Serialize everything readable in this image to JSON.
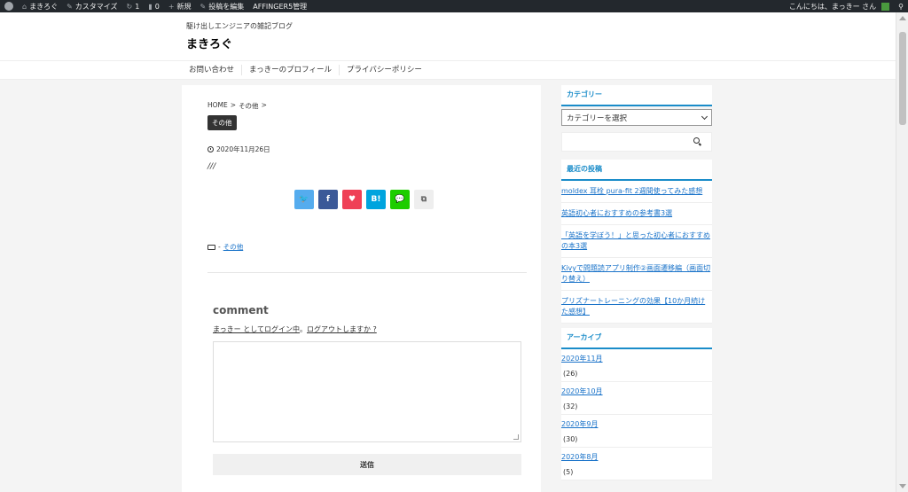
{
  "adminbar": {
    "site_name": "まきろぐ",
    "customize": "カスタマイズ",
    "updates_count": "1",
    "comments_count": "0",
    "new": "新規",
    "edit_post": "投稿を編集",
    "affinger": "AFFINGER5管理",
    "greeting": "こんにちは、まっきー さん"
  },
  "header": {
    "tagline": "駆け出しエンジニアの雑記ブログ",
    "site_title": "まきろぐ"
  },
  "nav": {
    "items": [
      "お問い合わせ",
      "まっきーのプロフィール",
      "プライバシーポリシー"
    ]
  },
  "post": {
    "breadcrumb": [
      "HOME",
      ">",
      "その他",
      ">"
    ],
    "category_badge": "その他",
    "date": "2020年11月26日",
    "body": "///",
    "share": {
      "twitter": "🐦",
      "facebook": "f",
      "pocket": "♥",
      "hatena": "B!",
      "line": "💬",
      "copy": "⧉"
    },
    "footer_category": "その他",
    "footer_prefix": "-"
  },
  "comment": {
    "title": "comment",
    "login_user": "まっきー としてログイン中",
    "separator": "。",
    "logout": "ログアウトしますか ?",
    "submit": "送信"
  },
  "sidebar": {
    "category_title": "カテゴリー",
    "category_select": "カテゴリーを選択",
    "recent_title": "最近の投稿",
    "recent_posts": [
      "moldex 耳栓 pura-fit 2週間使ってみた感想",
      "英語初心者におすすめの参考書3選",
      "「英語を学ぼう！」と思った初心者におすすめの本3選",
      "Kivyで問題読アプリ制作②画面遷移編（画面切り替え）",
      "プリズナートレーニングの効果【10か月続けた感想】"
    ],
    "archive_title": "アーカイブ",
    "archives": [
      {
        "label": "2020年11月",
        "count": "(26)"
      },
      {
        "label": "2020年10月",
        "count": "(32)"
      },
      {
        "label": "2020年9月",
        "count": "(30)"
      },
      {
        "label": "2020年8月",
        "count": "(5)"
      }
    ]
  },
  "colors": {
    "accent": "#1a8cc9",
    "link": "#1a73c9",
    "adminbar": "#23282d"
  }
}
